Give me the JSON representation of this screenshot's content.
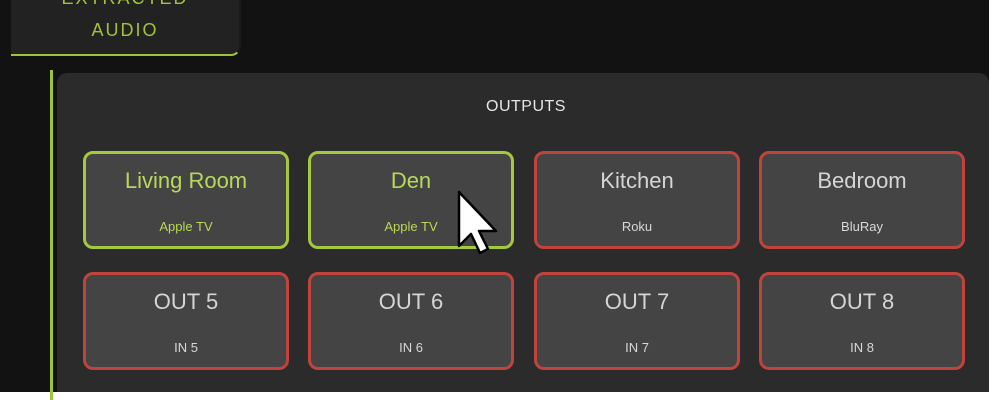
{
  "tab": {
    "line1": "EXTRACTED",
    "line2": "AUDIO"
  },
  "panel": {
    "title": "OUTPUTS"
  },
  "outputs": [
    {
      "name": "Living Room",
      "source": "Apple TV",
      "active": true
    },
    {
      "name": "Den",
      "source": "Apple TV",
      "active": true
    },
    {
      "name": "Kitchen",
      "source": "Roku",
      "active": false
    },
    {
      "name": "Bedroom",
      "source": "BluRay",
      "active": false
    },
    {
      "name": "OUT 5",
      "source": "IN 5",
      "active": false
    },
    {
      "name": "OUT 6",
      "source": "IN 6",
      "active": false
    },
    {
      "name": "OUT 7",
      "source": "IN 7",
      "active": false
    },
    {
      "name": "OUT 8",
      "source": "IN 8",
      "active": false
    }
  ],
  "colors": {
    "active": "#a4c93c",
    "inactive": "#c0433e",
    "accent": "#9fc43a",
    "tile_bg": "#444444",
    "panel_bg": "#2b2b2b",
    "background": "#121212"
  },
  "icons": {
    "cursor": "mouse-pointer-icon"
  }
}
